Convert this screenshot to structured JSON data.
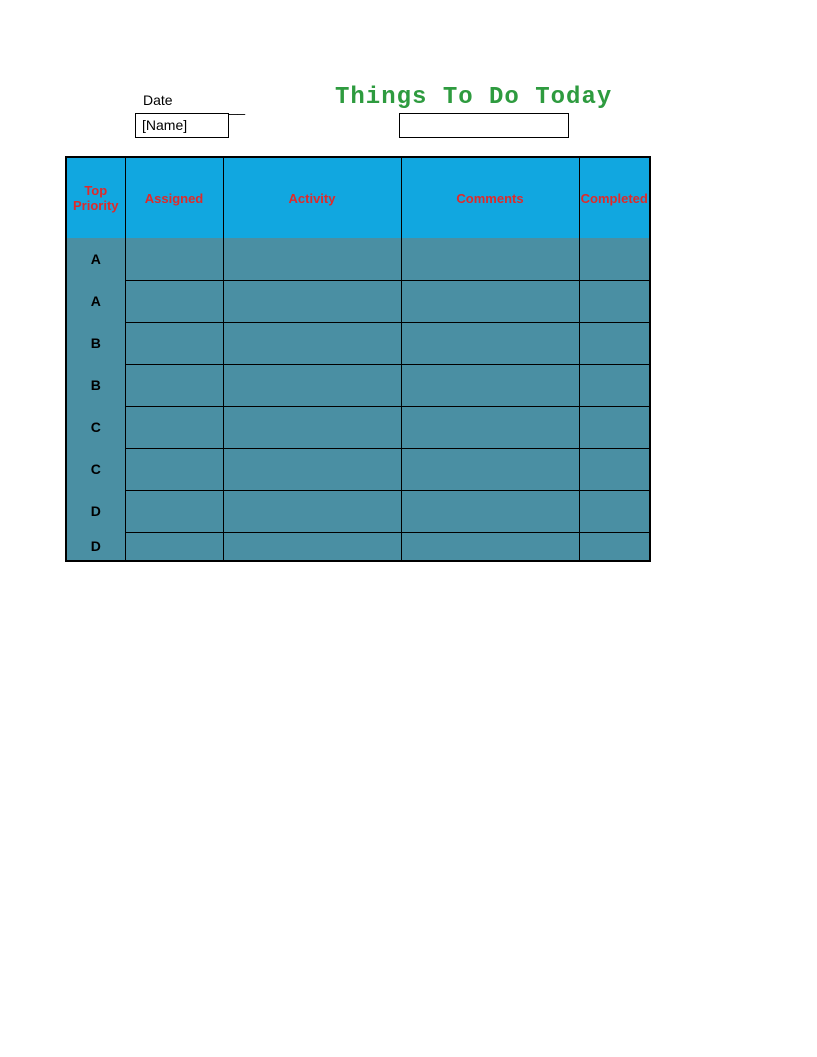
{
  "header": {
    "date_label": "Date",
    "date_blank": "_________",
    "title": "Things To Do Today",
    "name_placeholder": "[Name]",
    "blank_box": ""
  },
  "table": {
    "columns": [
      "Top Priority",
      "Assigned",
      "Activity",
      "Comments",
      "Completed"
    ],
    "rows": [
      {
        "priority": "A",
        "assigned": "",
        "activity": "",
        "comments": "",
        "completed": ""
      },
      {
        "priority": "A",
        "assigned": "",
        "activity": "",
        "comments": "",
        "completed": ""
      },
      {
        "priority": "B",
        "assigned": "",
        "activity": "",
        "comments": "",
        "completed": ""
      },
      {
        "priority": "B",
        "assigned": "",
        "activity": "",
        "comments": "",
        "completed": ""
      },
      {
        "priority": "C",
        "assigned": "",
        "activity": "",
        "comments": "",
        "completed": ""
      },
      {
        "priority": "C",
        "assigned": "",
        "activity": "",
        "comments": "",
        "completed": ""
      },
      {
        "priority": "D",
        "assigned": "",
        "activity": "",
        "comments": "",
        "completed": ""
      },
      {
        "priority": "D",
        "assigned": "",
        "activity": "",
        "comments": "",
        "completed": ""
      }
    ]
  }
}
